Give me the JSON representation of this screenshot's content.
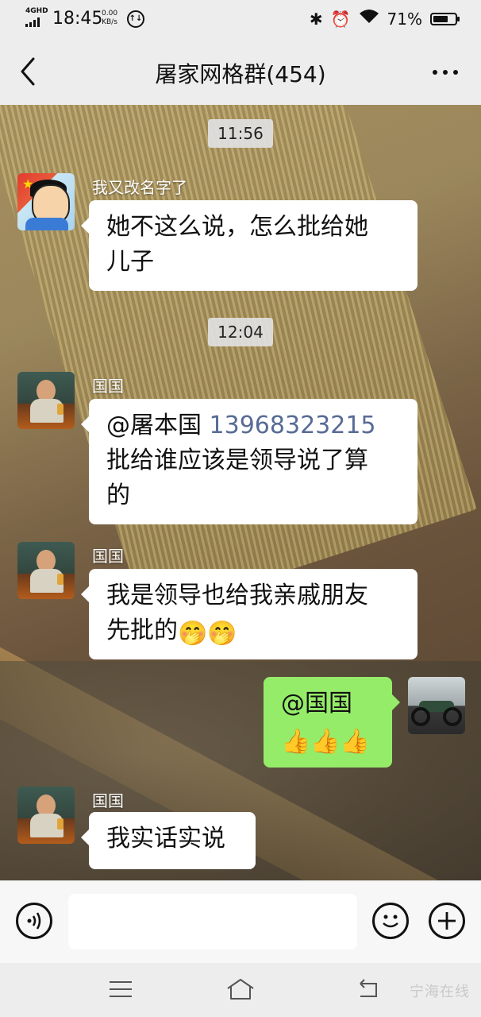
{
  "status_bar": {
    "network": "4GHD",
    "time": "18:45",
    "speed_value": "0.00",
    "speed_unit": "KB/s",
    "battery_percent": "71%",
    "battery_level": 0.71
  },
  "header": {
    "title": "屠家网格群(454)"
  },
  "messages": [
    {
      "type": "time",
      "text": "11:56"
    },
    {
      "type": "incoming",
      "sender": "我又改名字了",
      "text": "她不这么说，怎么批给她儿子",
      "line1": "她不这么说，怎么批给她",
      "line2": "儿子"
    },
    {
      "type": "time",
      "text": "12:04"
    },
    {
      "type": "incoming",
      "sender": "国国",
      "mention": "@屠本国",
      "number": "13968323215",
      "line2": "批给谁应该是领导说了算",
      "line3": "的"
    },
    {
      "type": "incoming",
      "sender": "国国",
      "line1": "我是领导也给我亲戚朋友",
      "line2": "先批的",
      "emoji": "🤭🤭"
    },
    {
      "type": "outgoing",
      "line1": "@国国",
      "emoji": "👍👍👍"
    },
    {
      "type": "incoming",
      "sender": "国国",
      "line1": "我实话实说"
    }
  ],
  "icons": {
    "back": "chevron-left-icon",
    "more": "more-dots-icon",
    "voice": "voice-icon",
    "emoji": "smile-icon",
    "plus": "plus-icon",
    "nav_menu": "menu-icon",
    "nav_home": "home-icon",
    "nav_back": "back-icon"
  },
  "watermark": "宁海在线"
}
